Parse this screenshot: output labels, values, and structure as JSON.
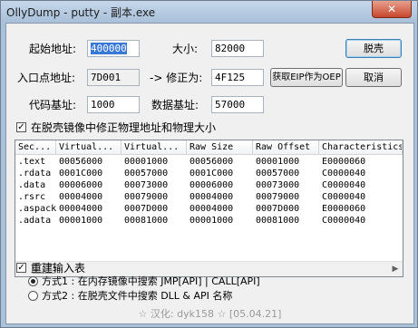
{
  "window": {
    "title": "OllyDump - putty - 副本.exe",
    "close_label": "✕"
  },
  "fields": {
    "start_label": "起始地址:",
    "start_value": "400000",
    "size_label": "大小:",
    "size_value": "82000",
    "entry_label": "入口点地址:",
    "entry_value": "7D001",
    "arrow_label": "-> 修正为:",
    "fixed_value": "4F125",
    "code_label": "代码基址:",
    "code_value": "1000",
    "data_label": "数据基址:",
    "data_value": "57000"
  },
  "buttons": {
    "dump": "脱壳",
    "get_eip": "获取EIP作为OEP",
    "cancel": "取消"
  },
  "options": {
    "fix_raw": "在脱壳镜像中修正物理地址和物理大小",
    "rebuild_import": "重建输入表",
    "method1": "方式1 : 在内存镜像中搜索 JMP[API] | CALL[API]",
    "method2": "方式2 : 在脱壳文件中搜索 DLL & API 名称"
  },
  "table": {
    "headers": [
      "Sec...",
      "Virtual...",
      "Virtual...",
      "Raw Size",
      "Raw Offset",
      "Characteristics"
    ],
    "rows": [
      [
        ".text",
        "00056000",
        "00001000",
        "00056000",
        "00001000",
        "E0000060"
      ],
      [
        ".rdata",
        "0001C000",
        "00057000",
        "0001C000",
        "00057000",
        "C0000040"
      ],
      [
        ".data",
        "00006000",
        "00073000",
        "00006000",
        "00073000",
        "C0000040"
      ],
      [
        ".rsrc",
        "00004000",
        "00079000",
        "00004000",
        "00079000",
        "C0000040"
      ],
      [
        ".aspack",
        "00004000",
        "0007D000",
        "00004000",
        "0007D000",
        "E0000060"
      ],
      [
        ".adata",
        "00001000",
        "00081000",
        "00001000",
        "00081000",
        "C0000040"
      ]
    ]
  },
  "status": "☆ 汉化: dyk158 ☆ [05.04.21]"
}
